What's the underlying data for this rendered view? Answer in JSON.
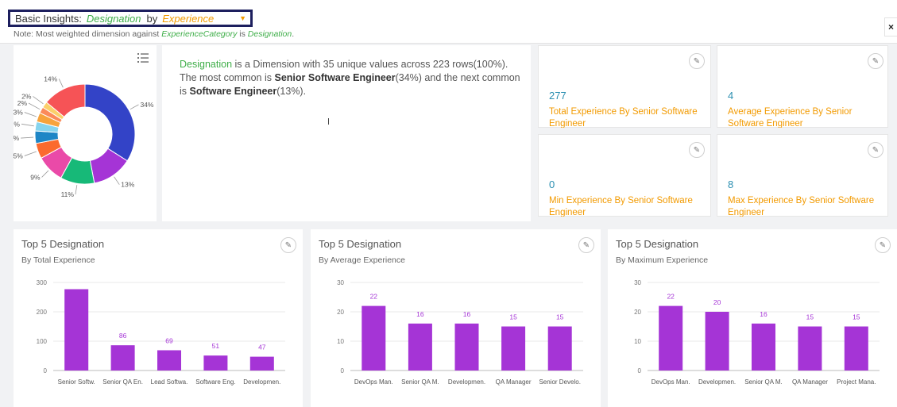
{
  "header": {
    "label": "Basic Insights:",
    "dimension": "Designation",
    "by": "by",
    "measure": "Experience",
    "note_prefix": "Note: Most weighted dimension against",
    "note_category": "ExperienceCategory",
    "note_is": "is",
    "note_dimension": "Designation",
    "note_suffix": ".",
    "close": "×"
  },
  "donut": {
    "percent_labels": [
      "34%",
      "13%",
      "11%",
      "9%",
      "5%",
      "4%",
      "3%",
      "3%",
      "2%",
      "2%",
      "14%"
    ],
    "slice_values": [
      34,
      13,
      11,
      9,
      5,
      4,
      3,
      3,
      2,
      2,
      14
    ],
    "slice_colors": [
      "#3343c7",
      "#a534d6",
      "#17b978",
      "#ea4aa8",
      "#fb6a2e",
      "#1e86c6",
      "#86d4ee",
      "#f7a33c",
      "#fb8a5a",
      "#fbd06b",
      "#f65356"
    ]
  },
  "summary": {
    "dimension": "Designation",
    "text1": " is a Dimension with 35 unique values across 223 rows(100%). The most common is ",
    "top1": "Senior Software Engineer",
    "pct1": "(34%) and the next common is ",
    "top2": "Software Engineer",
    "pct2": "(13%)."
  },
  "kpis": [
    {
      "value": "277",
      "label": "Total Experience By Senior Software Engineer"
    },
    {
      "value": "4",
      "label": "Average Experience By Senior Software Engineer"
    },
    {
      "value": "0",
      "label": "Min Experience By Senior Software Engineer"
    },
    {
      "value": "8",
      "label": "Max Experience By Senior Software Engineer"
    }
  ],
  "cards": [
    {
      "title": "Top 5 Designation",
      "subtitle": "By Total Experience"
    },
    {
      "title": "Top 5 Designation",
      "subtitle": "By Average Experience"
    },
    {
      "title": "Top 5 Designation",
      "subtitle": "By Maximum Experience"
    }
  ],
  "chart_data": [
    {
      "type": "bar",
      "title": "Top 5 Designation",
      "subtitle": "By Total Experience",
      "categories": [
        "Senior Softw.",
        "Senior QA En.",
        "Lead Softwa.",
        "Software Eng.",
        "Developmen."
      ],
      "values": [
        277,
        86,
        69,
        51,
        47
      ],
      "data_labels": [
        "",
        "86",
        "69",
        "51",
        "47"
      ],
      "yticks": [
        0,
        100,
        200,
        300
      ],
      "ylim": [
        0,
        300
      ],
      "bar_color": "#a534d6",
      "label_color": "#a534d6"
    },
    {
      "type": "bar",
      "title": "Top 5 Designation",
      "subtitle": "By Average Experience",
      "categories": [
        "DevOps Man.",
        "Senior QA M.",
        "Developmen.",
        "QA Manager",
        "Senior Develo."
      ],
      "values": [
        22,
        16,
        16,
        15,
        15
      ],
      "data_labels": [
        "22",
        "16",
        "16",
        "15",
        "15"
      ],
      "yticks": [
        0,
        10,
        20,
        30
      ],
      "ylim": [
        0,
        30
      ],
      "bar_color": "#a534d6",
      "label_color": "#a534d6"
    },
    {
      "type": "bar",
      "title": "Top 5 Designation",
      "subtitle": "By Maximum Experience",
      "categories": [
        "DevOps Man.",
        "Developmen.",
        "Senior QA M.",
        "QA Manager",
        "Project Mana."
      ],
      "values": [
        22,
        20,
        16,
        15,
        15
      ],
      "data_labels": [
        "22",
        "20",
        "16",
        "15",
        "15"
      ],
      "yticks": [
        0,
        10,
        20,
        30
      ],
      "ylim": [
        0,
        30
      ],
      "bar_color": "#a534d6",
      "label_color": "#a534d6"
    }
  ]
}
